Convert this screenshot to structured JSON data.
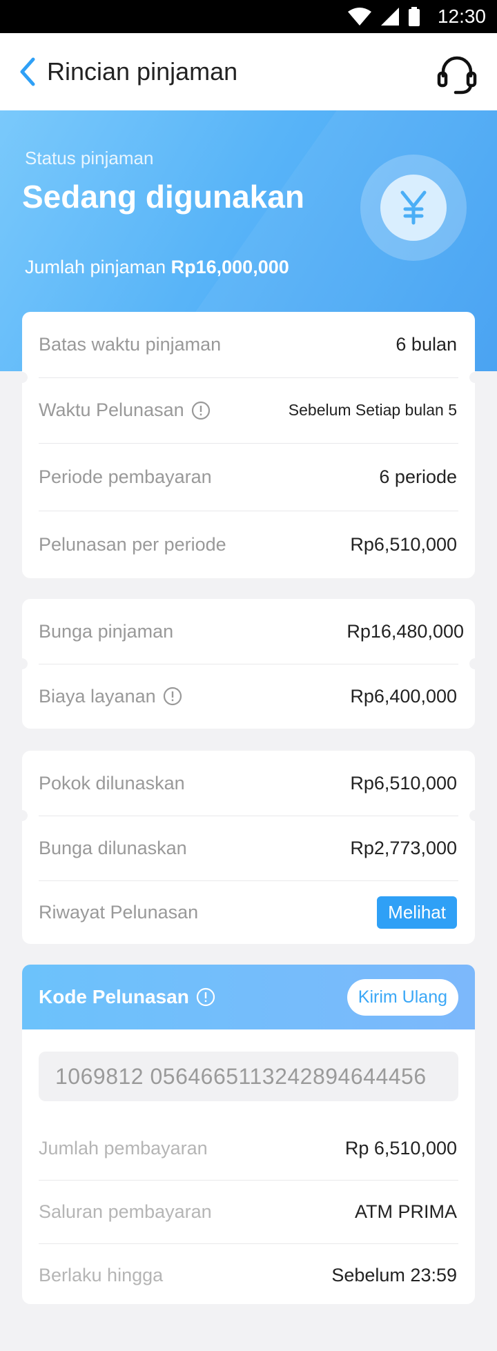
{
  "status_bar": {
    "time": "12:30"
  },
  "header": {
    "title": "Rincian pinjaman"
  },
  "hero": {
    "status_label": "Status pinjaman",
    "status_value": "Sedang digunakan",
    "amount_label": "Jumlah pinjaman",
    "amount_value": "Rp16,000,000",
    "coin_symbol": "¥"
  },
  "card1": {
    "rows": [
      {
        "label": "Batas waktu pinjaman",
        "value": "6 bulan"
      },
      {
        "label": "Waktu Pelunasan",
        "value": "Sebelum Setiap bulan 5"
      },
      {
        "label": "Periode pembayaran",
        "value": "6 periode"
      },
      {
        "label": "Pelunasan per periode",
        "value": "Rp6,510,000"
      }
    ]
  },
  "card2": {
    "rows": [
      {
        "label": "Bunga pinjaman",
        "value": "Rp16,480,000"
      },
      {
        "label": "Biaya layanan",
        "value": "Rp6,400,000"
      }
    ]
  },
  "card3": {
    "rows": [
      {
        "label": "Pokok dilunaskan",
        "value": "Rp6,510,000"
      },
      {
        "label": "Bunga dilunaskan",
        "value": "Rp2,773,000"
      },
      {
        "label": "Riwayat Pelunasan",
        "button": "Melihat"
      }
    ]
  },
  "repayment": {
    "title": "Kode Pelunasan",
    "resend_button": "Kirim Ulang",
    "code": "1069812 0564665113242894644456",
    "rows": [
      {
        "label": "Jumlah pembayaran",
        "value": "Rp 6,510,000"
      },
      {
        "label": "Saluran pembayaran",
        "value": "ATM PRIMA"
      },
      {
        "label": "Berlaku hingga",
        "value": "Sebelum 23:59"
      }
    ]
  },
  "colors": {
    "primary": "#2fa0f6",
    "hero_start": "#7ac9fb",
    "hero_end": "#3f9ef2"
  }
}
